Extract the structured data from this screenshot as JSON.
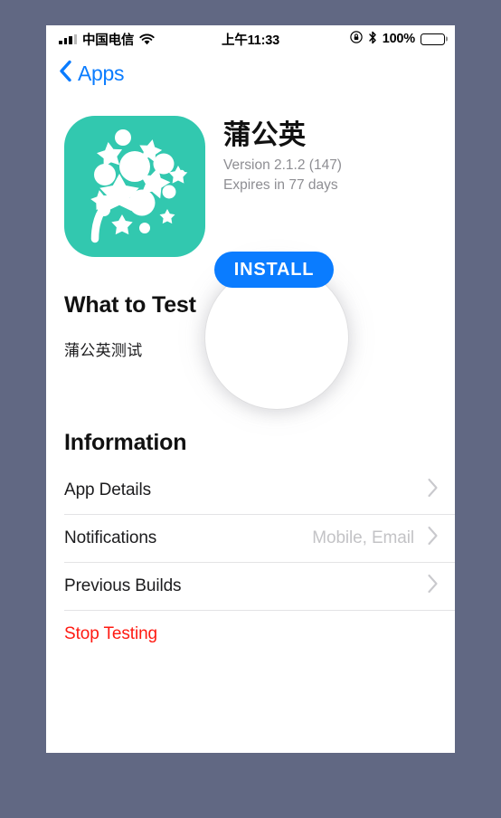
{
  "status_bar": {
    "carrier": "中国电信",
    "signal_icon": "signal-bars-icon",
    "wifi_icon": "wifi-icon",
    "time": "上午11:33",
    "rotation_lock_icon": "rotation-lock-icon",
    "bluetooth_icon": "bluetooth-icon",
    "battery_percent": "100%",
    "battery_icon": "battery-full-icon"
  },
  "nav": {
    "back_icon": "chevron-left-icon",
    "back_label": "Apps"
  },
  "app": {
    "icon_name": "dandelion-app-icon",
    "name": "蒲公英",
    "version": "Version 2.1.2 (147)",
    "expires": "Expires in 77 days",
    "install_label": "INSTALL"
  },
  "what_to_test": {
    "title": "What to Test",
    "body": "蒲公英测试"
  },
  "information": {
    "title": "Information",
    "rows": [
      {
        "label": "App Details",
        "value": "",
        "chevron": true,
        "destructive": false
      },
      {
        "label": "Notifications",
        "value": "Mobile, Email",
        "chevron": true,
        "destructive": false
      },
      {
        "label": "Previous Builds",
        "value": "",
        "chevron": true,
        "destructive": false
      },
      {
        "label": "Stop Testing",
        "value": "",
        "chevron": false,
        "destructive": true
      }
    ]
  },
  "colors": {
    "accent_blue": "#0a7cff",
    "app_icon_teal": "#32c8af",
    "destructive_red": "#ff1a12",
    "page_background": "#616883",
    "secondary_text": "#8e8e93"
  }
}
